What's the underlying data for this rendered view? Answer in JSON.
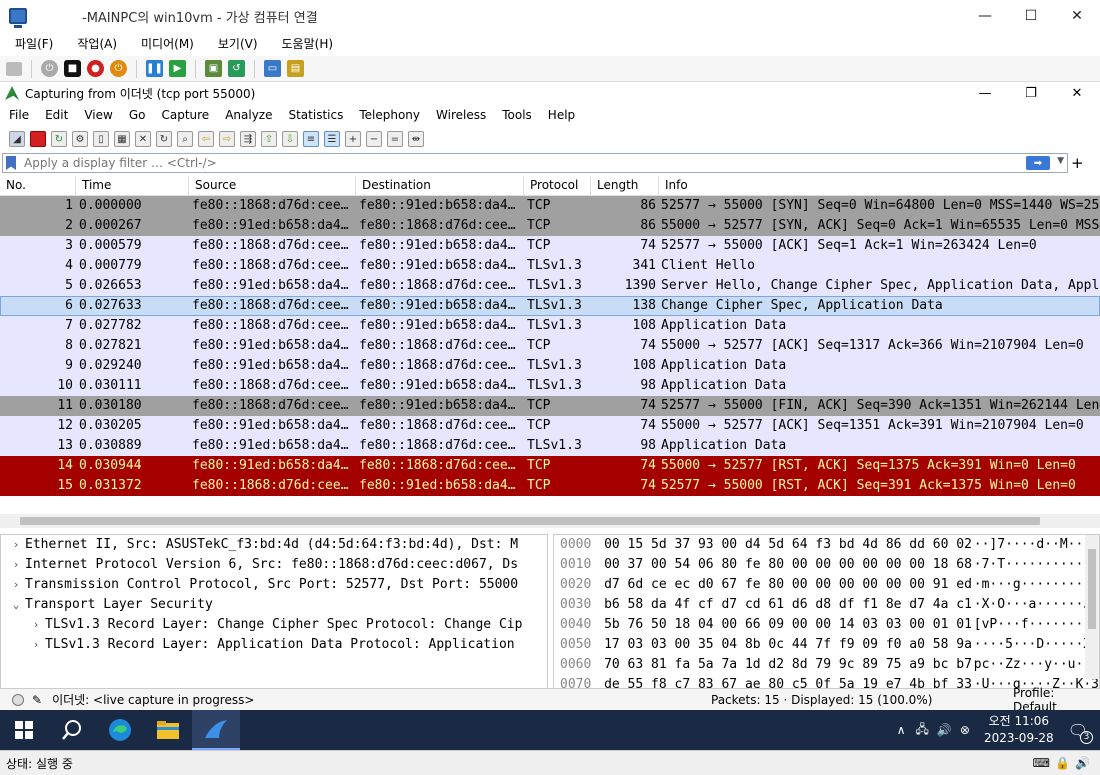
{
  "vm": {
    "title": "-MAINPC의 win10vm - 가상 컴퓨터 연결",
    "menu": [
      "파일(F)",
      "작업(A)",
      "미디어(M)",
      "보기(V)",
      "도움말(H)"
    ],
    "status": "상태: 실행 중"
  },
  "ws": {
    "title": "Capturing from 이더넷 (tcp port 55000)",
    "menu": [
      "File",
      "Edit",
      "View",
      "Go",
      "Capture",
      "Analyze",
      "Statistics",
      "Telephony",
      "Wireless",
      "Tools",
      "Help"
    ],
    "filter_placeholder": "Apply a display filter … <Ctrl-/>",
    "columns": [
      "No.",
      "Time",
      "Source",
      "Destination",
      "Protocol",
      "Length",
      "Info"
    ],
    "packets": [
      {
        "no": "1",
        "time": "0.000000",
        "src": "fe80::1868:d76d:cee…",
        "dst": "fe80::91ed:b658:da4…",
        "proto": "TCP",
        "len": "86",
        "info": "52577 → 55000 [SYN] Seq=0 Win=64800 Len=0 MSS=1440 WS=256 SACK_PERM",
        "style": "syn"
      },
      {
        "no": "2",
        "time": "0.000267",
        "src": "fe80::91ed:b658:da4…",
        "dst": "fe80::1868:d76d:cee…",
        "proto": "TCP",
        "len": "86",
        "info": "55000 → 52577 [SYN, ACK] Seq=0 Ack=1 Win=65535 Len=0 MSS=1440 WS=256",
        "style": "syn"
      },
      {
        "no": "3",
        "time": "0.000579",
        "src": "fe80::1868:d76d:cee…",
        "dst": "fe80::91ed:b658:da4…",
        "proto": "TCP",
        "len": "74",
        "info": "52577 → 55000 [ACK] Seq=1 Ack=1 Win=263424 Len=0",
        "style": "tcp"
      },
      {
        "no": "4",
        "time": "0.000779",
        "src": "fe80::1868:d76d:cee…",
        "dst": "fe80::91ed:b658:da4…",
        "proto": "TLSv1.3",
        "len": "341",
        "info": "Client Hello",
        "style": "tls"
      },
      {
        "no": "5",
        "time": "0.026653",
        "src": "fe80::91ed:b658:da4…",
        "dst": "fe80::1868:d76d:cee…",
        "proto": "TLSv1.3",
        "len": "1390",
        "info": "Server Hello, Change Cipher Spec, Application Data, Application Data",
        "style": "tls"
      },
      {
        "no": "6",
        "time": "0.027633",
        "src": "fe80::1868:d76d:cee…",
        "dst": "fe80::91ed:b658:da4…",
        "proto": "TLSv1.3",
        "len": "138",
        "info": "Change Cipher Spec, Application Data",
        "style": "sel"
      },
      {
        "no": "7",
        "time": "0.027782",
        "src": "fe80::1868:d76d:cee…",
        "dst": "fe80::91ed:b658:da4…",
        "proto": "TLSv1.3",
        "len": "108",
        "info": "Application Data",
        "style": "tls"
      },
      {
        "no": "8",
        "time": "0.027821",
        "src": "fe80::91ed:b658:da4…",
        "dst": "fe80::1868:d76d:cee…",
        "proto": "TCP",
        "len": "74",
        "info": "55000 → 52577 [ACK] Seq=1317 Ack=366 Win=2107904 Len=0",
        "style": "tcp"
      },
      {
        "no": "9",
        "time": "0.029240",
        "src": "fe80::91ed:b658:da4…",
        "dst": "fe80::1868:d76d:cee…",
        "proto": "TLSv1.3",
        "len": "108",
        "info": "Application Data",
        "style": "tls"
      },
      {
        "no": "10",
        "time": "0.030111",
        "src": "fe80::1868:d76d:cee…",
        "dst": "fe80::91ed:b658:da4…",
        "proto": "TLSv1.3",
        "len": "98",
        "info": "Application Data",
        "style": "tls"
      },
      {
        "no": "11",
        "time": "0.030180",
        "src": "fe80::1868:d76d:cee…",
        "dst": "fe80::91ed:b658:da4…",
        "proto": "TCP",
        "len": "74",
        "info": "52577 → 55000 [FIN, ACK] Seq=390 Ack=1351 Win=262144 Len=0",
        "style": "syn"
      },
      {
        "no": "12",
        "time": "0.030205",
        "src": "fe80::91ed:b658:da4…",
        "dst": "fe80::1868:d76d:cee…",
        "proto": "TCP",
        "len": "74",
        "info": "55000 → 52577 [ACK] Seq=1351 Ack=391 Win=2107904 Len=0",
        "style": "tcp"
      },
      {
        "no": "13",
        "time": "0.030889",
        "src": "fe80::91ed:b658:da4…",
        "dst": "fe80::1868:d76d:cee…",
        "proto": "TLSv1.3",
        "len": "98",
        "info": "Application Data",
        "style": "tls"
      },
      {
        "no": "14",
        "time": "0.030944",
        "src": "fe80::91ed:b658:da4…",
        "dst": "fe80::1868:d76d:cee…",
        "proto": "TCP",
        "len": "74",
        "info": "55000 → 52577 [RST, ACK] Seq=1375 Ack=391 Win=0 Len=0",
        "style": "rst"
      },
      {
        "no": "15",
        "time": "0.031372",
        "src": "fe80::1868:d76d:cee…",
        "dst": "fe80::91ed:b658:da4…",
        "proto": "TCP",
        "len": "74",
        "info": "52577 → 55000 [RST, ACK] Seq=391 Ack=1375 Win=0 Len=0",
        "style": "rst"
      }
    ],
    "details": [
      {
        "arrow": "›",
        "indent": 0,
        "text": "Ethernet II, Src: ASUSTekC_f3:bd:4d (d4:5d:64:f3:bd:4d), Dst: M"
      },
      {
        "arrow": "›",
        "indent": 0,
        "text": "Internet Protocol Version 6, Src: fe80::1868:d76d:ceec:d067, Ds"
      },
      {
        "arrow": "›",
        "indent": 0,
        "text": "Transmission Control Protocol, Src Port: 52577, Dst Port: 55000"
      },
      {
        "arrow": "⌄",
        "indent": 0,
        "text": "Transport Layer Security"
      },
      {
        "arrow": "›",
        "indent": 1,
        "text": "TLSv1.3 Record Layer: Change Cipher Spec Protocol: Change Cip"
      },
      {
        "arrow": "›",
        "indent": 1,
        "text": "TLSv1.3 Record Layer: Application Data Protocol: Application"
      }
    ],
    "bytes": [
      {
        "off": "0000",
        "hex": "00 15 5d 37 93 00 d4 5d  64 f3 bd 4d 86 dd 60 02",
        "asc": "··]7····d··M··`·"
      },
      {
        "off": "0010",
        "hex": "00 37 00 54 06 80 fe 80  00 00 00 00 00 00 18 68",
        "asc": "·7·T···········h"
      },
      {
        "off": "0020",
        "hex": "d7 6d ce ec d0 67 fe 80  00 00 00 00 00 00 91 ed",
        "asc": "·m···g··········"
      },
      {
        "off": "0030",
        "hex": "b6 58 da 4f cf d7 cd 61  d6 d8 df f1 8e d7 4a c1",
        "asc": "·X·O···a······J·"
      },
      {
        "off": "0040",
        "hex": "5b 76 50 18 04 00 66 09  00 00 14 03 03 00 01 01",
        "asc": "[vP···f·········"
      },
      {
        "off": "0050",
        "hex": "17 03 03 00 35 04 8b 0c  44 7f f9 09 f0 a0 58 9a",
        "asc": "····5···D·····X·"
      },
      {
        "off": "0060",
        "hex": "70 63 81 fa 5a 7a 1d d2  8d 79 9c 89 75 a9 bc b7",
        "asc": "pc··Zz···y··u···"
      },
      {
        "off": "0070",
        "hex": "de 55 f8 c7 83 67 ae 80  c5 0f 5a 19 e7 4b bf 33",
        "asc": "·U···g····Z··K·3"
      }
    ],
    "status": {
      "capture": "이더넷: <live capture in progress>",
      "packets": "Packets: 15 · Displayed: 15 (100.0%)",
      "profile": "Profile: Default"
    }
  },
  "taskbar": {
    "time": "오전 11:06",
    "date": "2023-09-28",
    "notif_count": "3"
  },
  "colors": {
    "tcp_bg": "#e7e6ff",
    "syn_bg": "#a0a0a0",
    "rst_bg": "#a40000",
    "rst_fg": "#fffc9c",
    "selected_bg": "#c8ddf5"
  }
}
